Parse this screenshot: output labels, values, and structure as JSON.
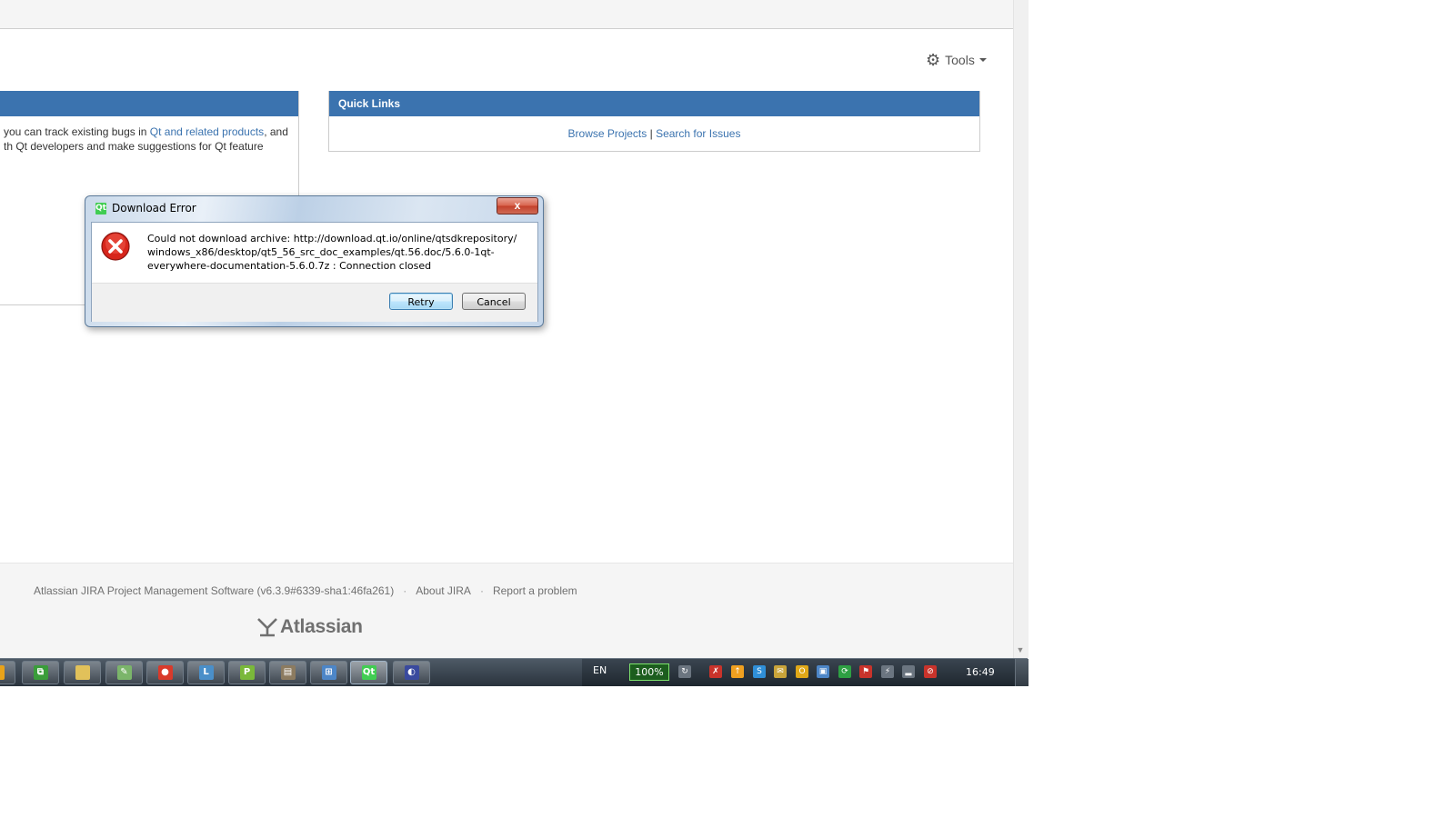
{
  "toolbar": {
    "tools_label": "Tools"
  },
  "intro_panel": {
    "text_before_link": "you can track existing bugs in ",
    "link_text": "Qt and related products",
    "text_after_link": ", and",
    "line2": "th Qt developers and make suggestions for Qt feature"
  },
  "quick_links": {
    "title": "Quick Links",
    "browse_projects": "Browse Projects",
    "separator": "|",
    "search_issues": "Search for Issues"
  },
  "footer": {
    "version_text": "Atlassian JIRA Project Management Software (v6.3.9#6339-sha1:46fa261)",
    "dot": "·",
    "about": "About JIRA",
    "report": "Report a problem",
    "logo_text": "Atlassian"
  },
  "dialog": {
    "title": "Download Error",
    "title_icon": "Qt",
    "close": "x",
    "line1": "Could not download archive: http://download.qt.io/online/qtsdkrepository/",
    "line2": "windows_x86/desktop/qt5_56_src_doc_examples/qt.56.doc/5.6.0-1qt-",
    "line3": "everywhere-documentation-5.6.0.7z : Connection closed",
    "retry": "Retry",
    "cancel": "Cancel"
  },
  "taskbar": {
    "apps": [
      {
        "name": "app-icon",
        "glyph": "",
        "color": "#e8a21a"
      },
      {
        "name": "switch-windows-icon",
        "glyph": "⧉",
        "color": "#3a9d3a"
      },
      {
        "name": "explorer-icon",
        "glyph": "",
        "color": "#e1c15a"
      },
      {
        "name": "notepad-icon",
        "glyph": "✎",
        "color": "#7bb56a"
      },
      {
        "name": "browser-icon",
        "glyph": "●",
        "color": "#d93a2b"
      },
      {
        "name": "l-app-icon",
        "glyph": "L",
        "color": "#4a8fc9"
      },
      {
        "name": "p-app-icon",
        "glyph": "P",
        "color": "#7ab83a"
      },
      {
        "name": "window-app-icon",
        "glyph": "▤",
        "color": "#8c7b60"
      },
      {
        "name": "network-app-icon",
        "glyph": "⊞",
        "color": "#4d86c7"
      },
      {
        "name": "qt-app-icon",
        "glyph": "Qt",
        "color": "#41cd52"
      },
      {
        "name": "media-app-icon",
        "glyph": "◐",
        "color": "#3a4a9e"
      }
    ],
    "lang": "EN",
    "battery": "100%",
    "tray_icons": [
      {
        "name": "sync-icon",
        "glyph": "↻",
        "color": "#6b7580"
      },
      {
        "name": "flag-alert-icon",
        "glyph": "✗",
        "color": "#c9332b"
      },
      {
        "name": "update-icon",
        "glyph": "↑",
        "color": "#f0a020"
      },
      {
        "name": "skype-icon",
        "glyph": "S",
        "color": "#2f8fd8"
      },
      {
        "name": "mail-icon",
        "glyph": "✉",
        "color": "#c9a43a"
      },
      {
        "name": "outlook-icon",
        "glyph": "O",
        "color": "#e0a818"
      },
      {
        "name": "display-icon",
        "glyph": "▣",
        "color": "#4d86c7"
      },
      {
        "name": "refresh-green-icon",
        "glyph": "⟳",
        "color": "#2ea043"
      },
      {
        "name": "action-center-flag-icon",
        "glyph": "⚑",
        "color": "#c9332b"
      },
      {
        "name": "power-icon",
        "glyph": "⚡",
        "color": "#6b7580"
      },
      {
        "name": "signal-icon",
        "glyph": "▂",
        "color": "#6b7580"
      },
      {
        "name": "volume-muted-icon",
        "glyph": "⊘",
        "color": "#c9332b"
      }
    ],
    "clock": "16:49"
  }
}
